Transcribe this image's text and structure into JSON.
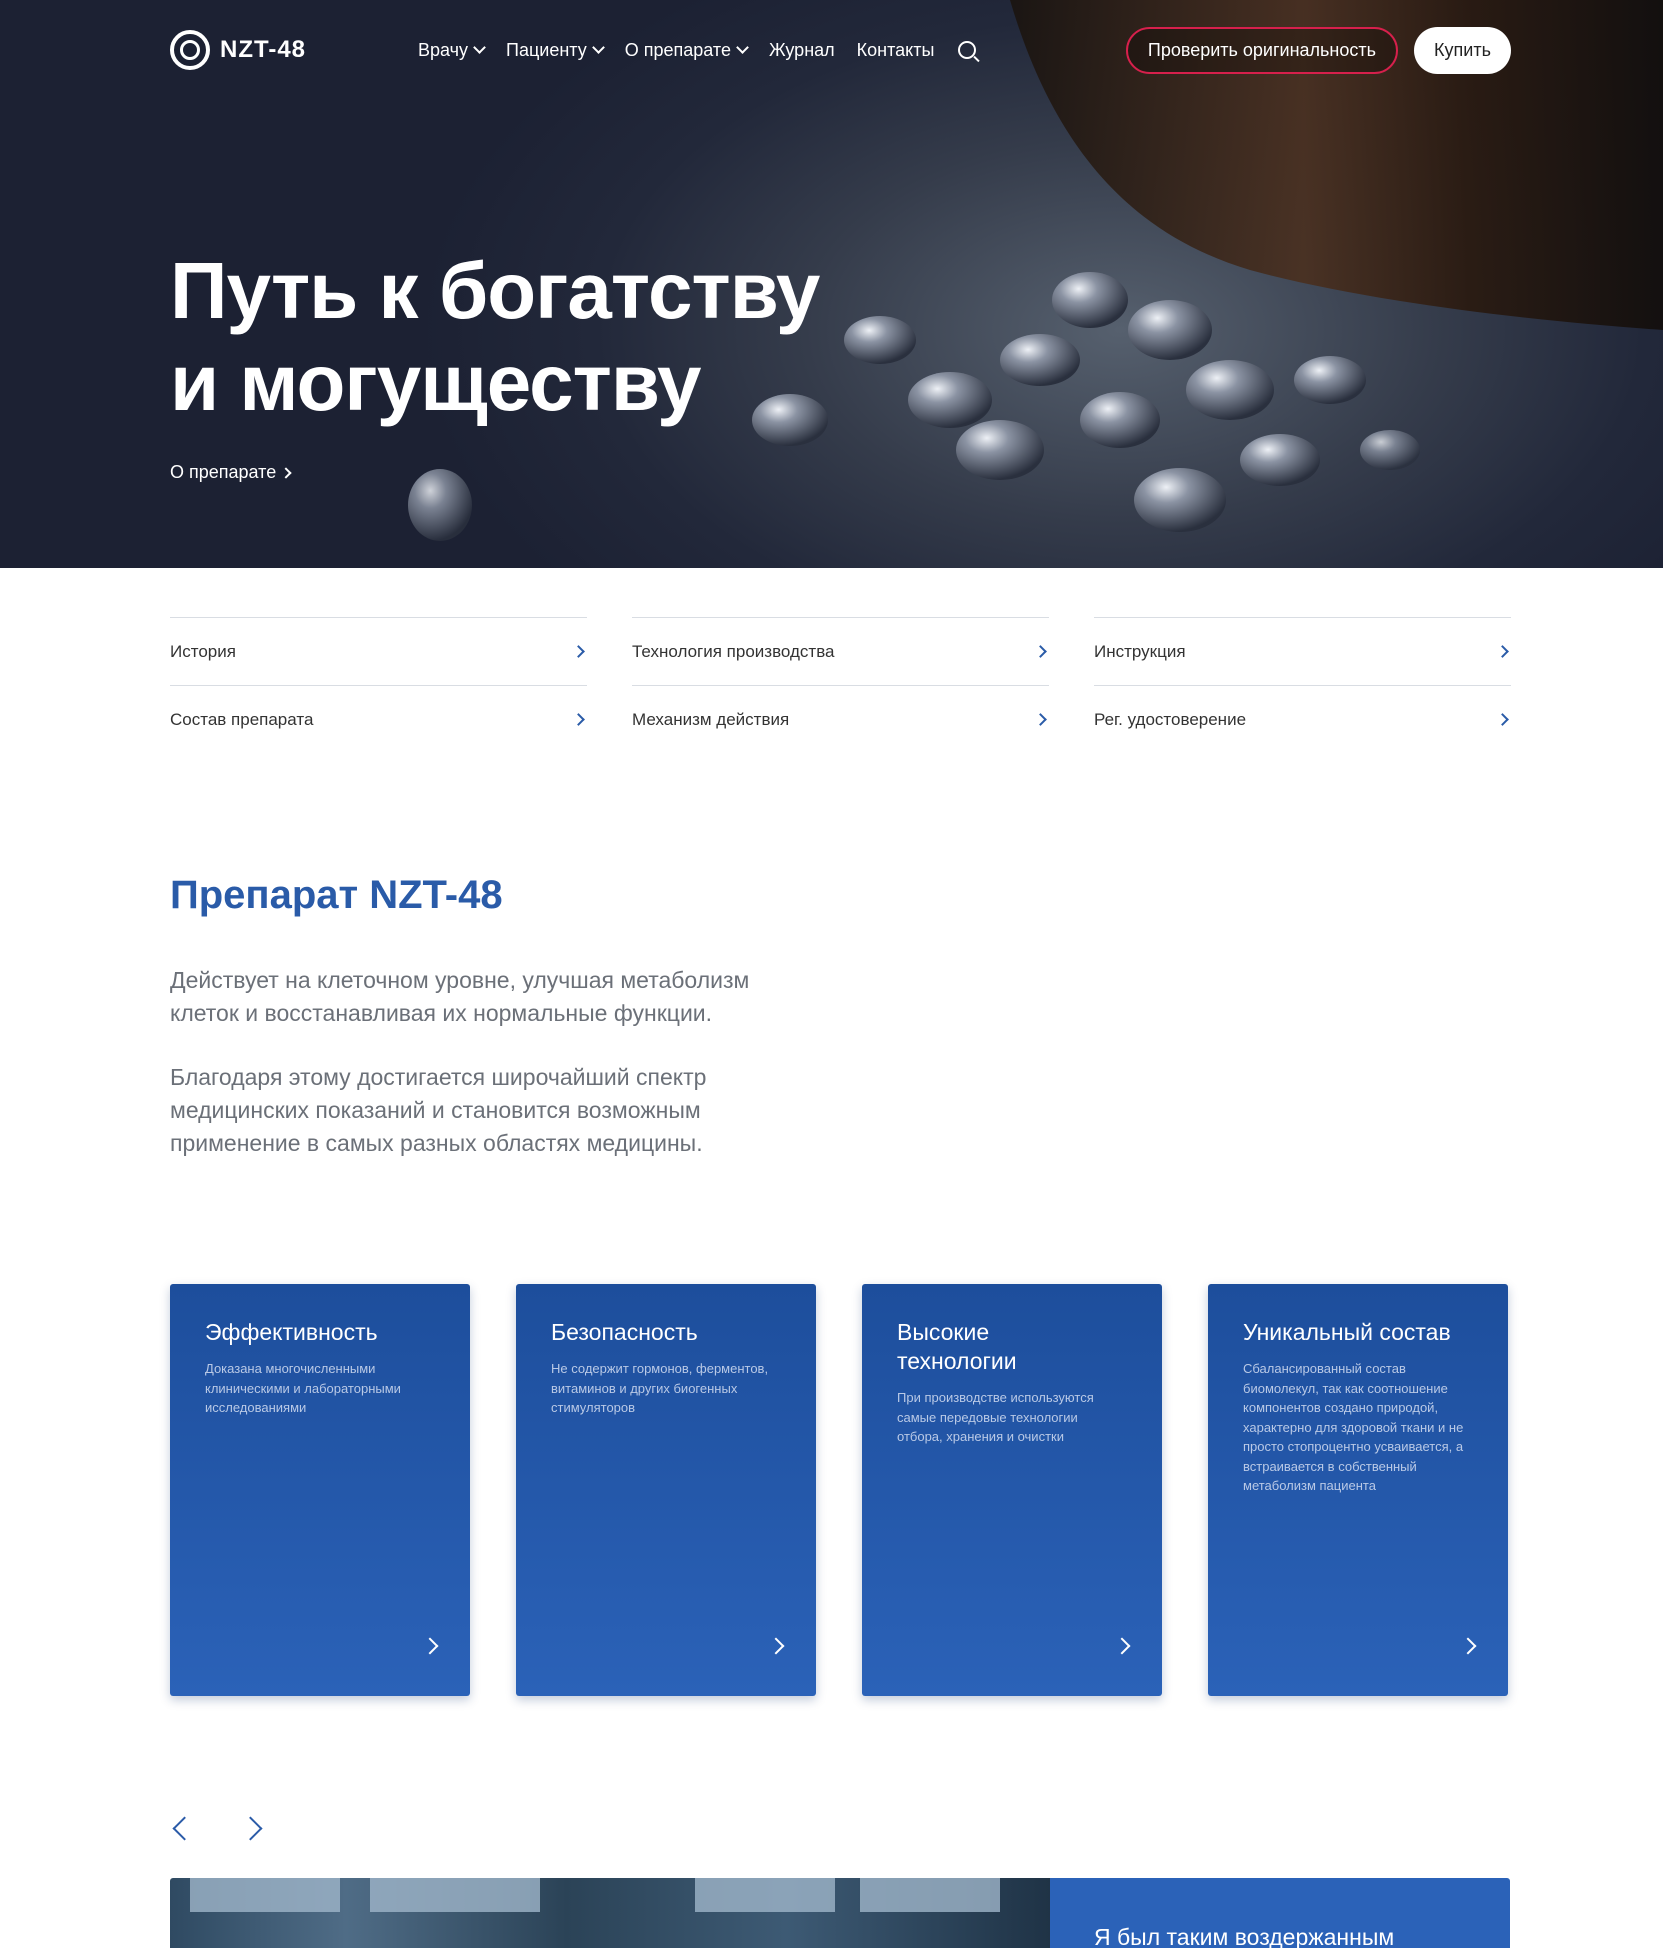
{
  "header": {
    "logo": "NZT-48",
    "nav": [
      {
        "label": "Врачу",
        "dropdown": true
      },
      {
        "label": "Пациенту",
        "dropdown": true
      },
      {
        "label": "О препарате",
        "dropdown": true
      },
      {
        "label": "Журнал",
        "dropdown": false
      },
      {
        "label": "Контакты",
        "dropdown": false
      }
    ],
    "check_button": "Проверить оригинальность",
    "buy_button": "Купить"
  },
  "hero": {
    "title_line1": "Путь к богатству",
    "title_line2": "и могуществу",
    "link": "О препарате"
  },
  "quick_links": [
    "История",
    "Технология производства",
    "Инструкция",
    "Состав препарата",
    "Механизм действия",
    "Рег. удостоверение"
  ],
  "about": {
    "title": "Препарат NZT-48",
    "paragraph1_line1": "Действует на клеточном уровне, улучшая метаболизм",
    "paragraph1_line2": "клеток и восстанавливая их нормальные функции.",
    "paragraph2_line1": "Благодаря этому достигается широчайший спектр",
    "paragraph2_line2": "медицинских показаний и становится возможным",
    "paragraph2_line3": "применение в самых разных областях медицины."
  },
  "cards": [
    {
      "title": "Эффективность",
      "desc": "Доказана многочисленными клиническими и лабораторными исследованиями"
    },
    {
      "title": "Безопасность",
      "desc": "Не содержит гормонов, ферментов, витаминов и других биогенных стимуляторов"
    },
    {
      "title": "Высокие технологии",
      "desc": "При производстве используются самые передовые технологии отбора, хранения и очистки"
    },
    {
      "title": "Уникальный состав",
      "desc": "Сбалансированный состав биомолекул, так как соотношение компонентов создано природой, характерно для здоровой ткани и не просто стопроцентно усваивается, а встраивается в собственный метаболизм пациента"
    }
  ],
  "testimonial": {
    "quote_start": "Я был таким воздержанным"
  },
  "colors": {
    "accent_blue": "#2a5ba8",
    "card_blue": "#1d4e9c",
    "check_border": "#d6204c"
  }
}
